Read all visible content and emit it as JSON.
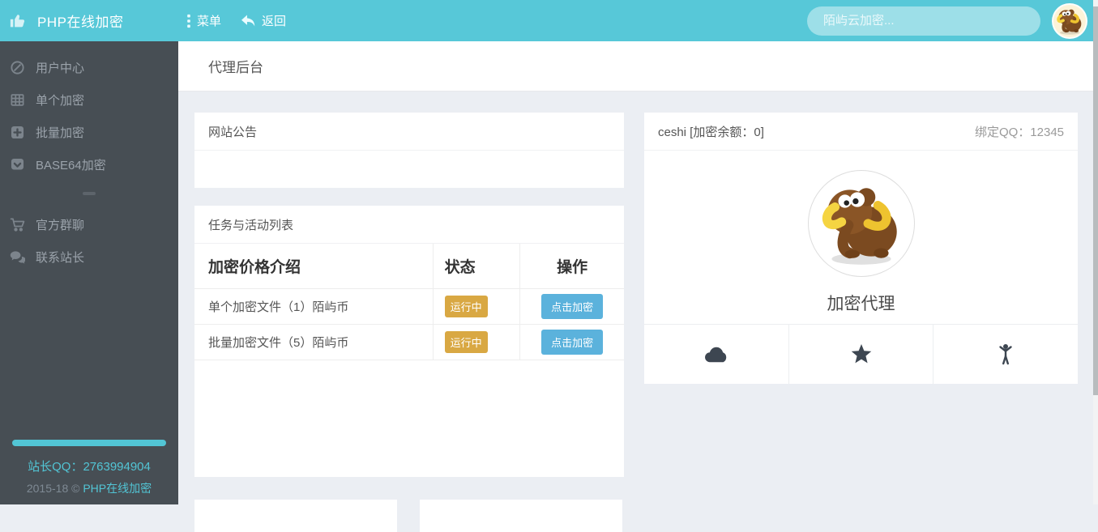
{
  "theme": {
    "accent": "#57c8d8",
    "sidebar_bg": "#474e54",
    "badge_color": "#d9a843",
    "button_color": "#5bb2dc",
    "content_bg": "#ebeef3"
  },
  "header": {
    "logo_icon": "thumbs-up-icon",
    "logo_text": "PHP在线加密",
    "menu_label": "菜单",
    "back_label": "返回",
    "search_placeholder": "陌屿云加密...",
    "avatar": "mammoth-avatar"
  },
  "sidebar": {
    "items": [
      {
        "label": "用户中心",
        "icon": "ban-circle-icon"
      },
      {
        "label": "单个加密",
        "icon": "table-icon"
      },
      {
        "label": "批量加密",
        "icon": "plus-square-icon"
      },
      {
        "label": "BASE64加密",
        "icon": "chevron-square-icon"
      },
      {
        "label": "官方群聊",
        "icon": "cart-icon"
      },
      {
        "label": "联系站长",
        "icon": "comments-icon"
      }
    ],
    "footer": {
      "qq_line": "站长QQ：2763994904",
      "copyright_prefix": "2015-18 © ",
      "copyright_brand": "PHP在线加密"
    }
  },
  "page": {
    "title": "代理后台"
  },
  "announcement": {
    "title": "网站公告"
  },
  "tasks": {
    "title": "任务与活动列表",
    "columns": {
      "name": "加密价格介绍",
      "status": "状态",
      "action": "操作"
    },
    "rows": [
      {
        "name": "单个加密文件（1）陌屿币",
        "status": "运行中",
        "action": "点击加密"
      },
      {
        "name": "批量加密文件（5）陌屿币",
        "status": "运行中",
        "action": "点击加密"
      }
    ]
  },
  "profile": {
    "user_line": "ceshi [加密余额：0]",
    "qq_line": "绑定QQ：12345",
    "avatar": "mammoth-avatar",
    "role": "加密代理",
    "footer_icons": [
      "cloud-icon",
      "star-icon",
      "person-icon"
    ]
  }
}
